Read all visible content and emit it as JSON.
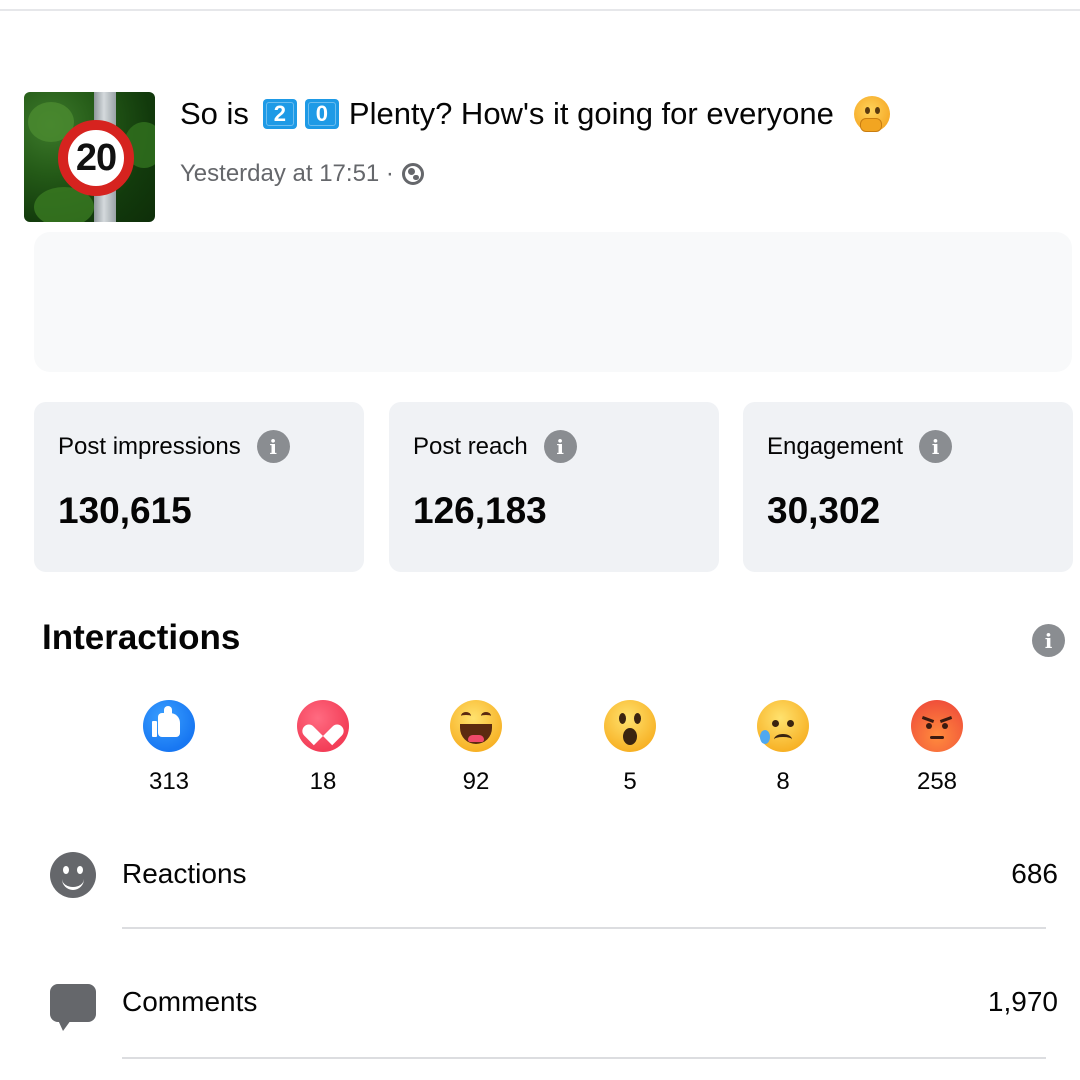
{
  "post": {
    "thumbnail_sign_text": "20",
    "title_before": "So is",
    "title_key1": "2",
    "title_key2": "0",
    "title_after": "Plenty? How's it going for everyone",
    "timestamp": "Yesterday at 17:51 ·",
    "privacy_icon": "globe-icon",
    "title_emoji": "thinking-face-emoji"
  },
  "stats": [
    {
      "label": "Post impressions",
      "value": "130,615"
    },
    {
      "label": "Post reach",
      "value": "126,183"
    },
    {
      "label": "Engagement",
      "value": "30,302"
    }
  ],
  "interactions": {
    "title": "Interactions",
    "reactions": [
      {
        "type": "like",
        "icon": "like-icon",
        "count": "313"
      },
      {
        "type": "love",
        "icon": "love-icon",
        "count": "18"
      },
      {
        "type": "haha",
        "icon": "haha-icon",
        "count": "92"
      },
      {
        "type": "wow",
        "icon": "wow-icon",
        "count": "5"
      },
      {
        "type": "sad",
        "icon": "sad-icon",
        "count": "8"
      },
      {
        "type": "angry",
        "icon": "angry-icon",
        "count": "258"
      }
    ],
    "rows": [
      {
        "icon": "smiley-icon",
        "label": "Reactions",
        "value": "686"
      },
      {
        "icon": "comment-icon",
        "label": "Comments",
        "value": "1,970"
      }
    ]
  },
  "colors": {
    "card_background": "#f0f2f5",
    "info_icon": "#8a8d91",
    "like_blue": "#1877f2",
    "love_red": "#f33e58",
    "text_secondary": "#65676b"
  }
}
